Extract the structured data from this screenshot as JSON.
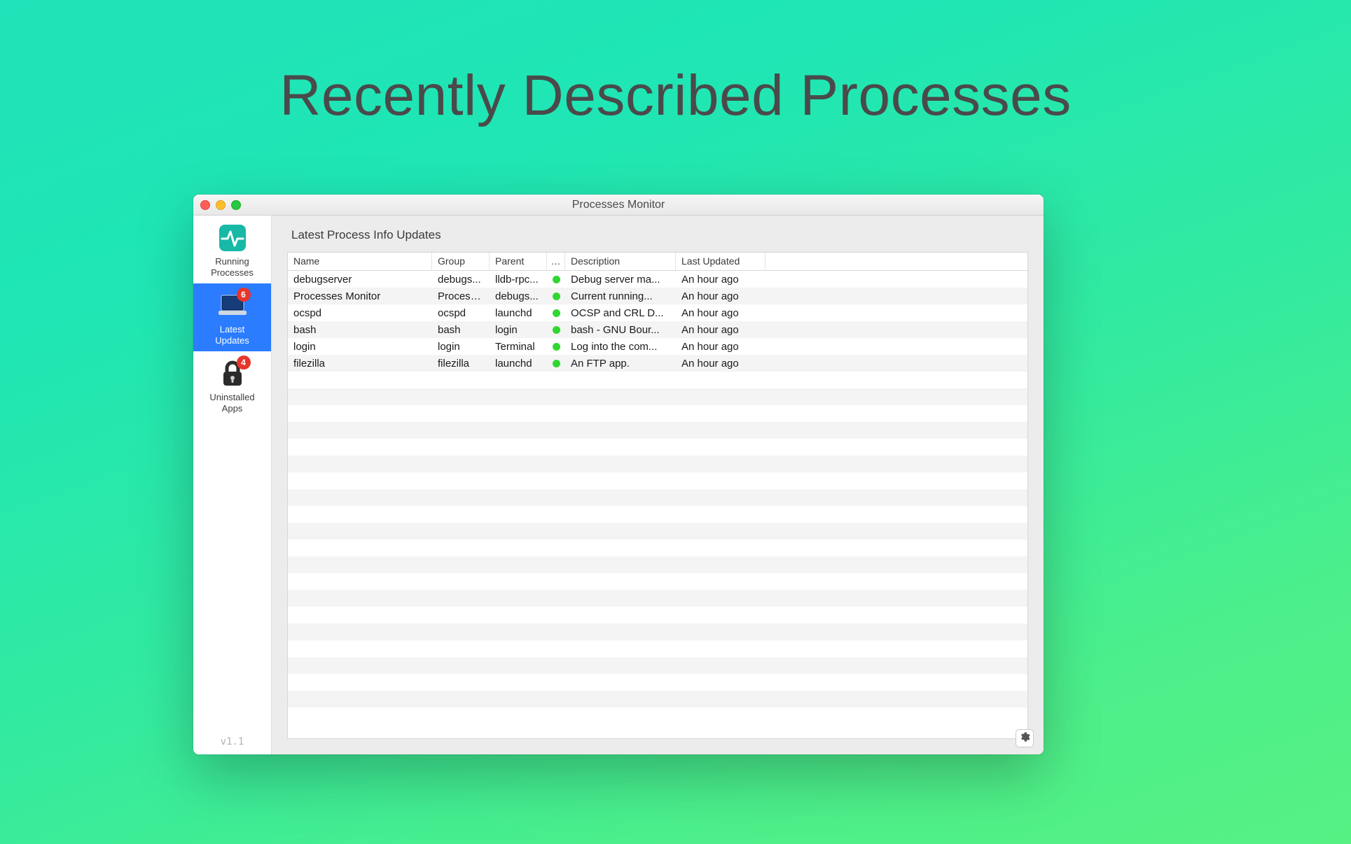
{
  "promo_title": "Recently Described Processes",
  "window": {
    "title": "Processes Monitor",
    "version": "v1.1"
  },
  "sidebar": {
    "items": [
      {
        "id": "running",
        "label_line1": "Running",
        "label_line2": "Processes",
        "badge": null
      },
      {
        "id": "updates",
        "label_line1": "Latest",
        "label_line2": "Updates",
        "badge": "6"
      },
      {
        "id": "uninstall",
        "label_line1": "Uninstalled",
        "label_line2": "Apps",
        "badge": "4"
      }
    ],
    "selected_index": 1
  },
  "content": {
    "header": "Latest Process Info Updates",
    "columns": {
      "name": "Name",
      "group": "Group",
      "parent": "Parent",
      "status": "…",
      "description": "Description",
      "updated": "Last Updated"
    },
    "rows": [
      {
        "name": "debugserver",
        "group": "debugs...",
        "parent": "lldb-rpc...",
        "status": "green",
        "description": "Debug server ma...",
        "updated": "An hour ago"
      },
      {
        "name": "Processes Monitor",
        "group": "Process...",
        "parent": "debugs...",
        "status": "green",
        "description": "Current running...",
        "updated": "An hour ago"
      },
      {
        "name": "ocspd",
        "group": "ocspd",
        "parent": "launchd",
        "status": "green",
        "description": "OCSP and CRL D...",
        "updated": "An hour ago"
      },
      {
        "name": "bash",
        "group": "bash",
        "parent": "login",
        "status": "green",
        "description": "bash - GNU Bour...",
        "updated": "An hour ago"
      },
      {
        "name": "login",
        "group": "login",
        "parent": "Terminal",
        "status": "green",
        "description": "Log into the com...",
        "updated": "An hour ago"
      },
      {
        "name": "filezilla",
        "group": "filezilla",
        "parent": "launchd",
        "status": "green",
        "description": "An FTP app.",
        "updated": "An hour ago"
      }
    ],
    "empty_rows": 20
  }
}
